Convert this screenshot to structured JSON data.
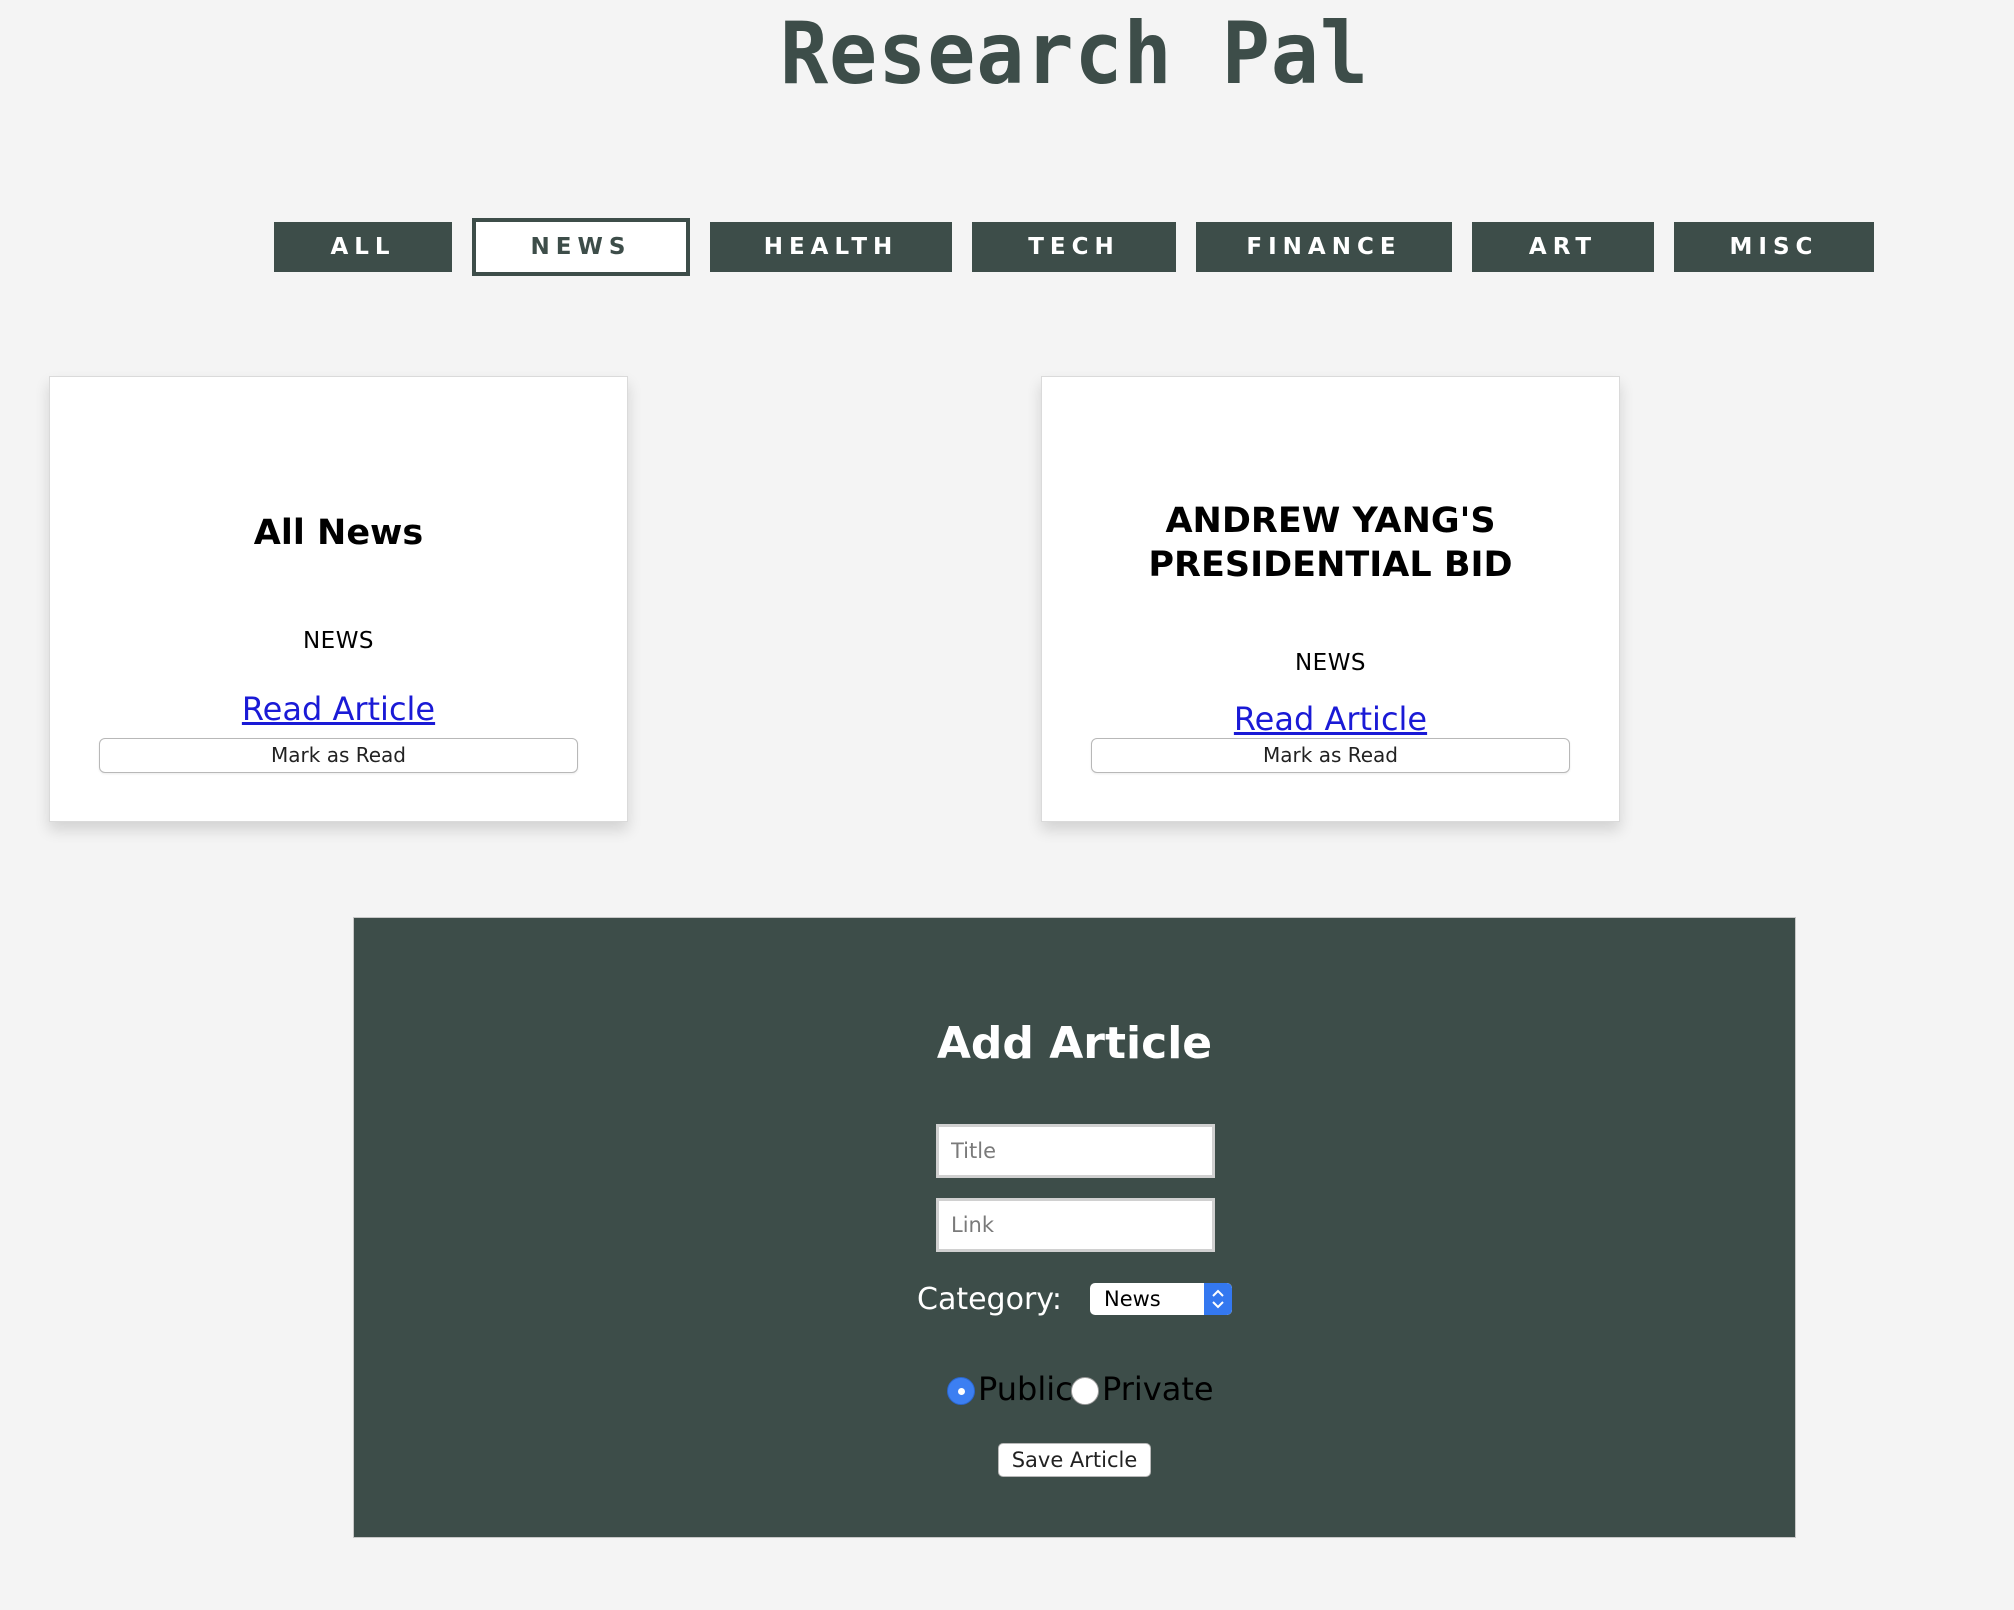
{
  "header": {
    "title": "Research Pal"
  },
  "filters": {
    "items": [
      {
        "label": "ALL",
        "active": false
      },
      {
        "label": "NEWS",
        "active": true
      },
      {
        "label": "HEALTH",
        "active": false
      },
      {
        "label": "TECH",
        "active": false
      },
      {
        "label": "FINANCE",
        "active": false
      },
      {
        "label": "ART",
        "active": false
      },
      {
        "label": "MISC",
        "active": false
      }
    ]
  },
  "cards": [
    {
      "title": "All News",
      "category": "NEWS",
      "link_label": "Read Article",
      "mark_read_label": "Mark as Read"
    },
    {
      "title": "ANDREW YANG'S PRESIDENTIAL BID",
      "category": "NEWS",
      "link_label": "Read Article",
      "mark_read_label": "Mark as Read"
    }
  ],
  "add_article": {
    "heading": "Add Article",
    "title_placeholder": "Title",
    "link_placeholder": "Link",
    "category_label": "Category:",
    "category_selected": "News",
    "visibility_options": [
      {
        "label": "Public",
        "checked": true
      },
      {
        "label": "Private",
        "checked": false
      }
    ],
    "save_label": "Save Article"
  },
  "colors": {
    "brand": "#3d4d49",
    "page_background": "#f4f4f4",
    "link": "#1a1ad6",
    "radio_accent": "#3c7ff2"
  }
}
